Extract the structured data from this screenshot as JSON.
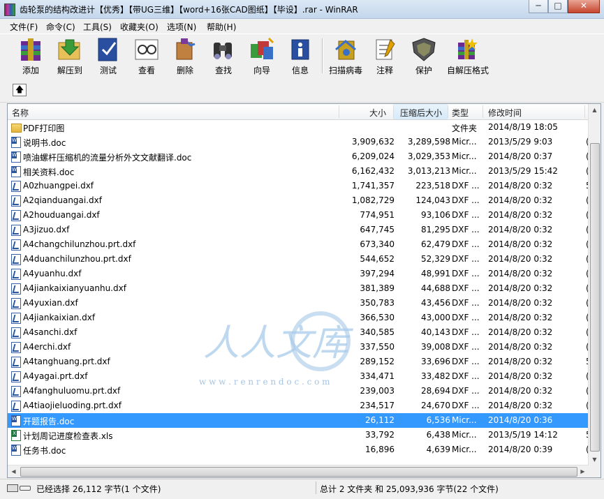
{
  "window": {
    "title": "齿轮泵的结构改进计【优秀】【带UG三维】【word+16张CAD图纸】【毕设】.rar - WinRAR"
  },
  "menu": [
    "文件(F)",
    "命令(C)",
    "工具(S)",
    "收藏夹(O)",
    "选项(N)",
    "帮助(H)"
  ],
  "toolbar": [
    {
      "label": "添加",
      "icon": "add-archive-icon"
    },
    {
      "label": "解压到",
      "icon": "extract-to-icon"
    },
    {
      "label": "测试",
      "icon": "test-icon"
    },
    {
      "label": "查看",
      "icon": "view-icon"
    },
    {
      "label": "删除",
      "icon": "delete-icon"
    },
    {
      "label": "查找",
      "icon": "find-icon"
    },
    {
      "label": "向导",
      "icon": "wizard-icon"
    },
    {
      "label": "信息",
      "icon": "info-icon"
    },
    {
      "label": "扫描病毒",
      "icon": "virus-scan-icon"
    },
    {
      "label": "注释",
      "icon": "comment-icon"
    },
    {
      "label": "保护",
      "icon": "protect-icon"
    },
    {
      "label": "自解压格式",
      "icon": "sfx-icon"
    }
  ],
  "columns": {
    "name": "名称",
    "size": "大小",
    "packed": "压缩后大小",
    "type": "类型",
    "modified": "修改时间"
  },
  "files": [
    {
      "name": "PDF打印图",
      "size": "",
      "packed": "",
      "type": "文件夹",
      "modified": "2014/8/19 18:05",
      "icon": "folder",
      "extra": ""
    },
    {
      "name": "说明书.doc",
      "size": "3,909,632",
      "packed": "3,289,598",
      "type": "Micr...",
      "modified": "2013/5/29 9:03",
      "icon": "doc",
      "extra": "("
    },
    {
      "name": "喷油螺杆压缩机的流量分析外文文献翻译.doc",
      "size": "6,209,024",
      "packed": "3,029,353",
      "type": "Micr...",
      "modified": "2014/8/20 0:37",
      "icon": "doc",
      "extra": "("
    },
    {
      "name": "相关资料.doc",
      "size": "6,162,432",
      "packed": "3,013,213",
      "type": "Micr...",
      "modified": "2013/5/29 15:42",
      "icon": "doc",
      "extra": "("
    },
    {
      "name": "A0zhuangpei.dxf",
      "size": "1,741,357",
      "packed": "223,518",
      "type": "DXF ...",
      "modified": "2014/8/20 0:32",
      "icon": "dxf",
      "extra": "5"
    },
    {
      "name": "A2qianduangai.dxf",
      "size": "1,082,729",
      "packed": "124,043",
      "type": "DXF ...",
      "modified": "2014/8/20 0:32",
      "icon": "dxf",
      "extra": "("
    },
    {
      "name": "A2houduangai.dxf",
      "size": "774,951",
      "packed": "93,106",
      "type": "DXF ...",
      "modified": "2014/8/20 0:32",
      "icon": "dxf",
      "extra": "("
    },
    {
      "name": "A3jizuo.dxf",
      "size": "647,745",
      "packed": "81,295",
      "type": "DXF ...",
      "modified": "2014/8/20 0:32",
      "icon": "dxf",
      "extra": "("
    },
    {
      "name": "A4changchilunzhou.prt.dxf",
      "size": "673,340",
      "packed": "62,479",
      "type": "DXF ...",
      "modified": "2014/8/20 0:32",
      "icon": "dxf",
      "extra": "("
    },
    {
      "name": "A4duanchilunzhou.prt.dxf",
      "size": "544,652",
      "packed": "52,329",
      "type": "DXF ...",
      "modified": "2014/8/20 0:32",
      "icon": "dxf",
      "extra": "("
    },
    {
      "name": "A4yuanhu.dxf",
      "size": "397,294",
      "packed": "48,991",
      "type": "DXF ...",
      "modified": "2014/8/20 0:32",
      "icon": "dxf",
      "extra": "("
    },
    {
      "name": "A4jiankaixianyuanhu.dxf",
      "size": "381,389",
      "packed": "44,688",
      "type": "DXF ...",
      "modified": "2014/8/20 0:32",
      "icon": "dxf",
      "extra": "("
    },
    {
      "name": "A4yuxian.dxf",
      "size": "350,783",
      "packed": "43,456",
      "type": "DXF ...",
      "modified": "2014/8/20 0:32",
      "icon": "dxf",
      "extra": "("
    },
    {
      "name": "A4jiankaixian.dxf",
      "size": "366,530",
      "packed": "43,000",
      "type": "DXF ...",
      "modified": "2014/8/20 0:32",
      "icon": "dxf",
      "extra": "("
    },
    {
      "name": "A4sanchi.dxf",
      "size": "340,585",
      "packed": "40,143",
      "type": "DXF ...",
      "modified": "2014/8/20 0:32",
      "icon": "dxf",
      "extra": "("
    },
    {
      "name": "A4erchi.dxf",
      "size": "337,550",
      "packed": "39,008",
      "type": "DXF ...",
      "modified": "2014/8/20 0:32",
      "icon": "dxf",
      "extra": "("
    },
    {
      "name": "A4tanghuang.prt.dxf",
      "size": "289,152",
      "packed": "33,696",
      "type": "DXF ...",
      "modified": "2014/8/20 0:32",
      "icon": "dxf",
      "extra": "5"
    },
    {
      "name": "A4yagai.prt.dxf",
      "size": "334,471",
      "packed": "33,482",
      "type": "DXF ...",
      "modified": "2014/8/20 0:32",
      "icon": "dxf",
      "extra": "("
    },
    {
      "name": "A4fanghuluomu.prt.dxf",
      "size": "239,003",
      "packed": "28,694",
      "type": "DXF ...",
      "modified": "2014/8/20 0:32",
      "icon": "dxf",
      "extra": "("
    },
    {
      "name": "A4tiaojieluoding.prt.dxf",
      "size": "234,517",
      "packed": "24,670",
      "type": "DXF ...",
      "modified": "2014/8/20 0:32",
      "icon": "dxf",
      "extra": "("
    },
    {
      "name": "开题报告.doc",
      "size": "26,112",
      "packed": "6,536",
      "type": "Micr...",
      "modified": "2014/8/20 0:36",
      "icon": "doc",
      "extra": "",
      "selected": true
    },
    {
      "name": "计划周记进度检查表.xls",
      "size": "33,792",
      "packed": "6,438",
      "type": "Micr...",
      "modified": "2013/5/19 14:12",
      "icon": "xls",
      "extra": "5"
    },
    {
      "name": "任务书.doc",
      "size": "16,896",
      "packed": "4,639",
      "type": "Micr...",
      "modified": "2014/8/20 0:39",
      "icon": "doc",
      "extra": "("
    }
  ],
  "status": {
    "left": "已经选择 26,112 字节(1 个文件)",
    "right": "总计 2 文件夹 和 25,093,936 字节(22 个文件)"
  },
  "watermark": {
    "text": "人人文库",
    "url": "w w w . r e n r e n d o c . c o m"
  }
}
